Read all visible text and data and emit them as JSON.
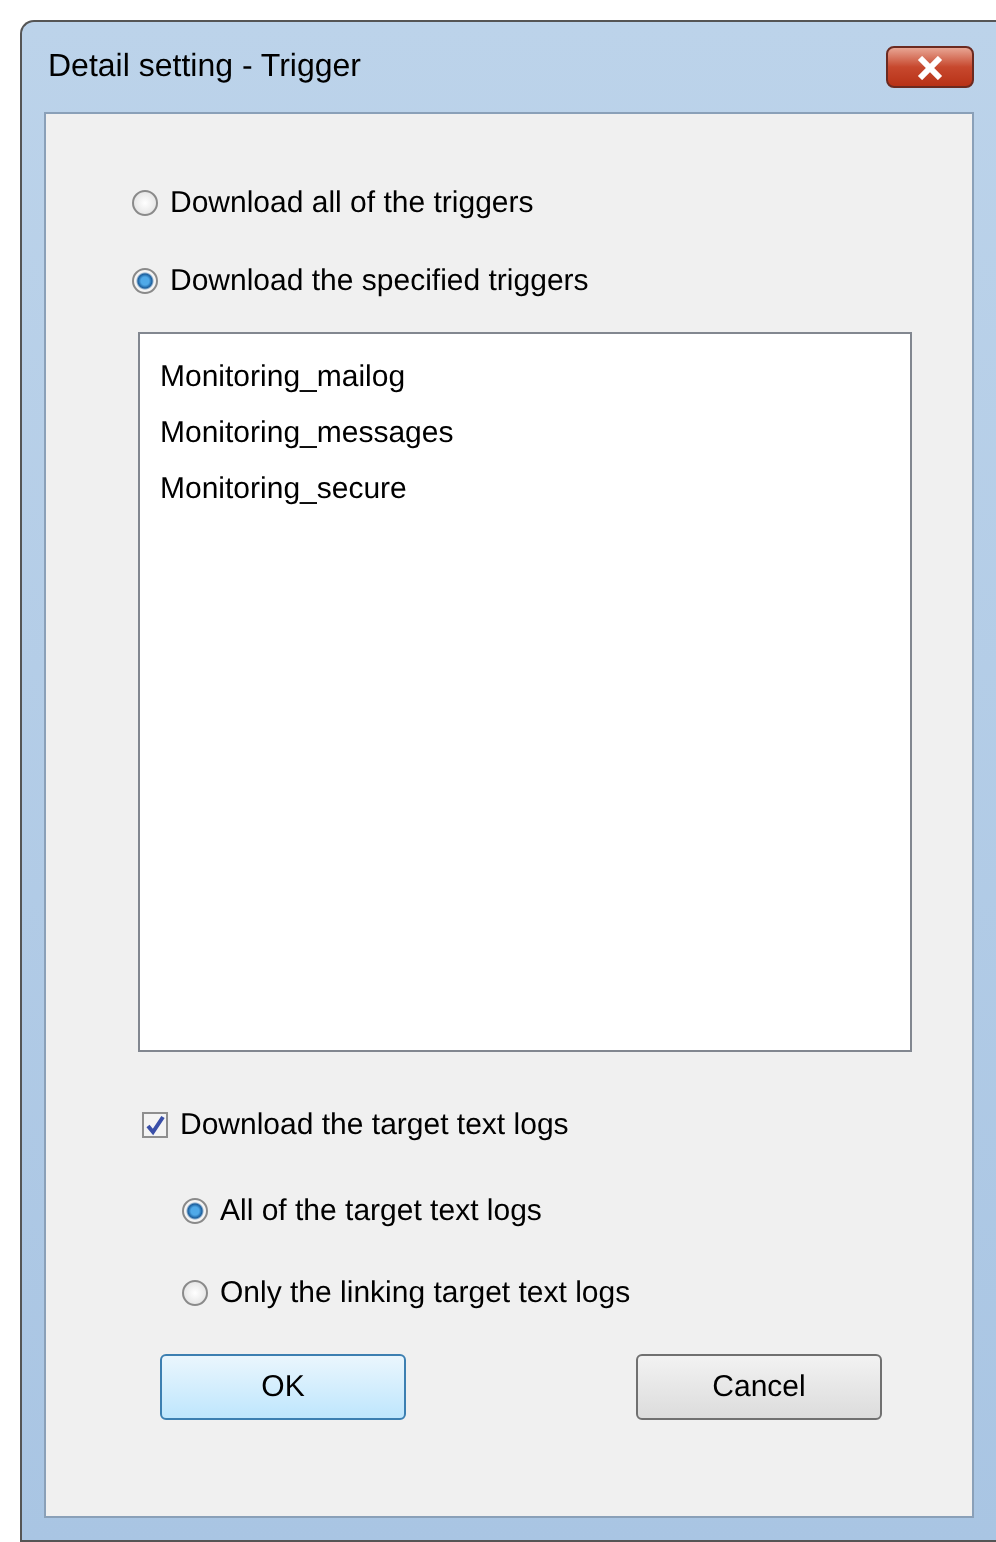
{
  "window": {
    "title": "Detail setting - Trigger"
  },
  "trigger_options": [
    {
      "label": "Download all of the triggers",
      "selected": false
    },
    {
      "label": "Download the specified triggers",
      "selected": true
    }
  ],
  "trigger_list": [
    "Monitoring_mailog",
    "Monitoring_messages",
    "Monitoring_secure"
  ],
  "text_logs": {
    "label": "Download the target text logs",
    "checked": true
  },
  "text_log_options": [
    {
      "label": "All of the target text logs",
      "selected": true
    },
    {
      "label": "Only the linking target text logs",
      "selected": false
    }
  ],
  "buttons": [
    {
      "label": "OK",
      "kind": "default"
    },
    {
      "label": "Cancel",
      "kind": "normal"
    }
  ]
}
